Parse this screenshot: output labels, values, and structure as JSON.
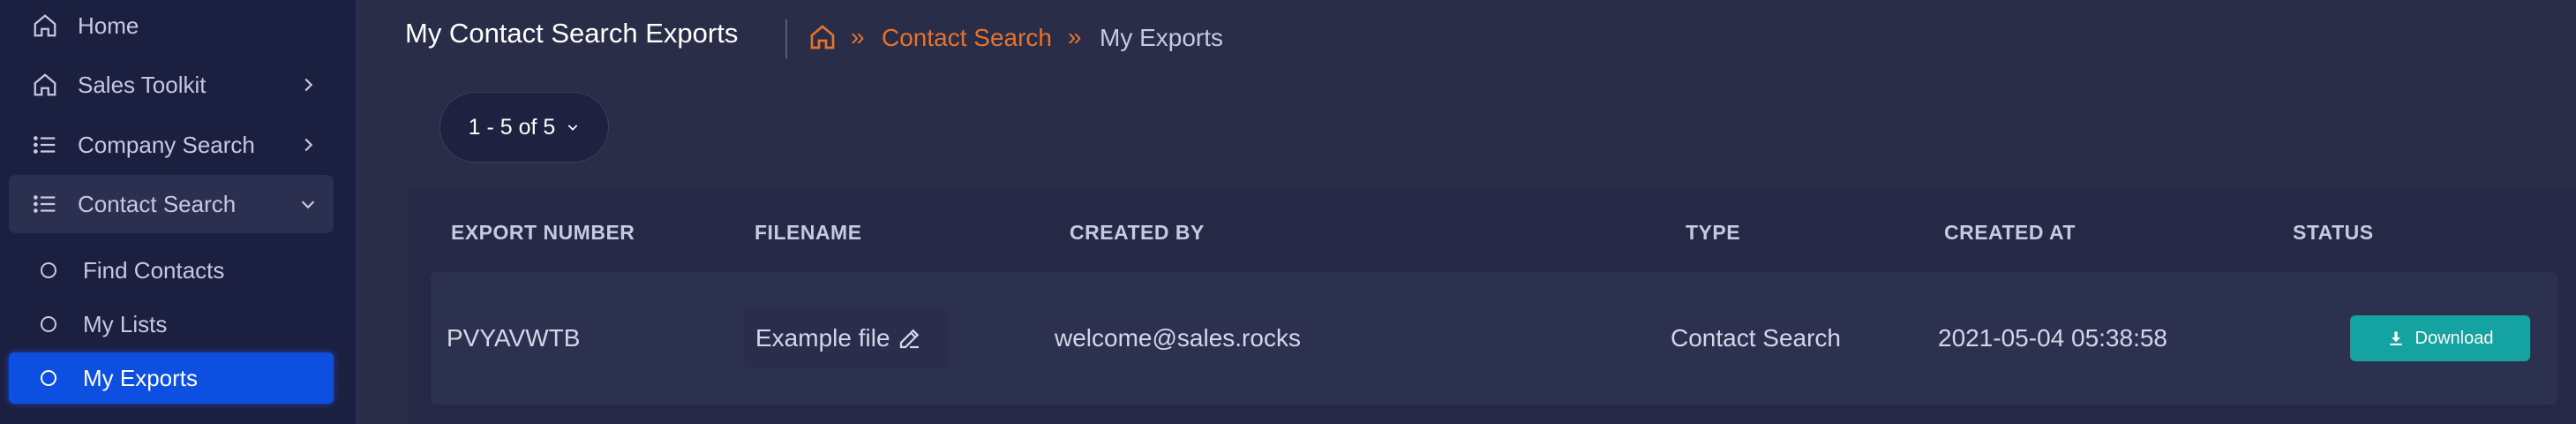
{
  "sidebar": {
    "items": [
      {
        "label": "Home",
        "icon": "home-icon"
      },
      {
        "label": "Sales Toolkit",
        "icon": "home-icon"
      },
      {
        "label": "Company Search",
        "icon": "list-icon"
      },
      {
        "label": "Contact Search",
        "icon": "list-icon"
      }
    ],
    "sub_items": [
      {
        "label": "Find Contacts"
      },
      {
        "label": "My Lists"
      },
      {
        "label": "My Exports"
      }
    ]
  },
  "header": {
    "title": "My Contact Search Exports",
    "breadcrumb": {
      "link": "Contact Search",
      "current": "My Exports",
      "separator": "»"
    }
  },
  "pagination": {
    "range": "1 - 5 of 5"
  },
  "table": {
    "columns": [
      "EXPORT NUMBER",
      "FILENAME",
      "CREATED BY",
      "TYPE",
      "CREATED AT",
      "STATUS"
    ],
    "rows": [
      {
        "export_number": "PVYAVWTB",
        "filename": "Example file",
        "created_by": "welcome@sales.rocks",
        "type": "Contact Search",
        "created_at": "2021-05-04 05:38:58",
        "status_action": "Download"
      }
    ]
  },
  "colors": {
    "accent": "#e5732e",
    "selected": "#0d4fe0",
    "download": "#14a3a0"
  }
}
